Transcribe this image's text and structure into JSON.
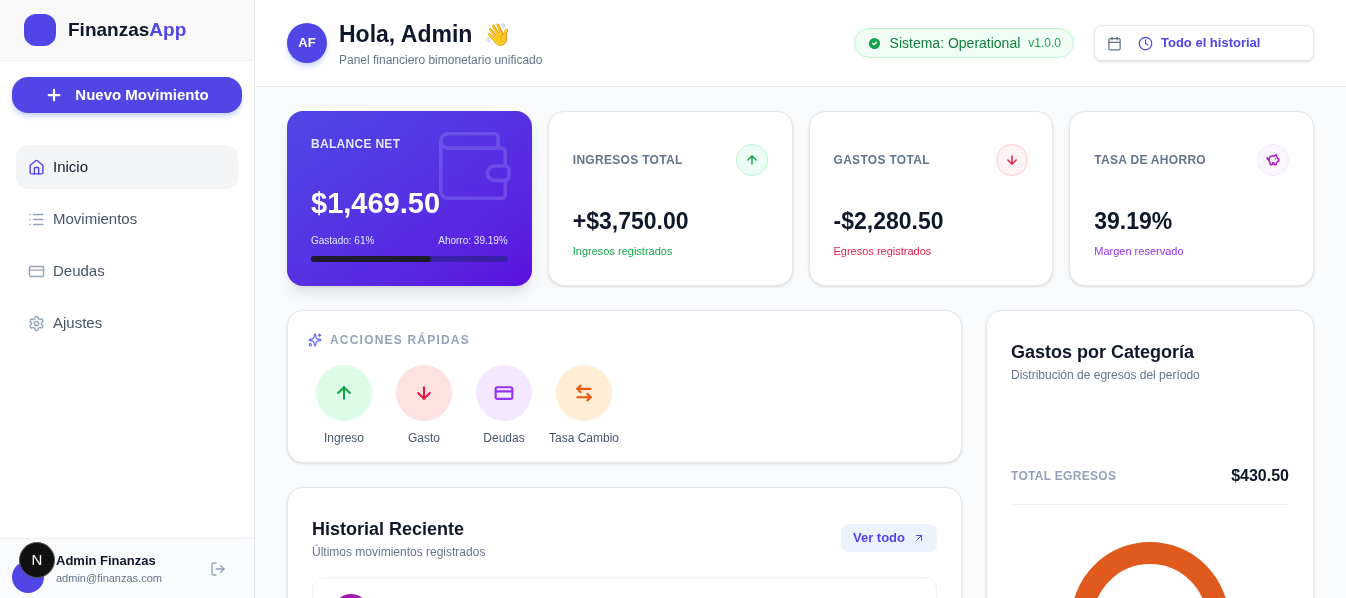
{
  "brand": {
    "name": "Finanzas",
    "accent": "App"
  },
  "new_button": "Nuevo Movimiento",
  "nav": [
    {
      "label": "Inicio",
      "kind": "home",
      "selected": true
    },
    {
      "label": "Movimientos",
      "kind": "list",
      "selected": false
    },
    {
      "label": "Deudas",
      "kind": "card",
      "selected": false
    },
    {
      "label": "Ajustes",
      "kind": "gear",
      "selected": false
    }
  ],
  "user": {
    "initial": "N",
    "name": "Admin Finanzas",
    "email": "admin@finanzas.com"
  },
  "header": {
    "avatar": "AF",
    "title": "Hola, Admin",
    "emoji": "👋",
    "subtitle": "Panel financiero bimonetario unificado",
    "status": "Sistema: Operational",
    "version": "v1.0.0",
    "range": "Todo el historial"
  },
  "balance": {
    "label": "BALANCE NET",
    "value": "$1,469.50",
    "spent": "Gastado: 61%",
    "saved": "Ahorro: 39.19%",
    "level": 0.61
  },
  "stats": [
    {
      "label": "INGRESOS TOTAL",
      "value": "+$3,750.00",
      "note": "Ingresos registrados",
      "kind": "up"
    },
    {
      "label": "GASTOS TOTAL",
      "value": "-$2,280.50",
      "note": "Egresos registrados",
      "kind": "down"
    },
    {
      "label": "TASA DE AHORRO",
      "value": "39.19%",
      "note": "Margen reservado",
      "kind": "piggy"
    }
  ],
  "quick_actions": {
    "title": "ACCIONES RÁPIDAS",
    "items": [
      {
        "label": "Ingreso",
        "kind": "up"
      },
      {
        "label": "Gasto",
        "kind": "down"
      },
      {
        "label": "Deudas",
        "kind": "card"
      },
      {
        "label": "Tasa Cambio",
        "kind": "swap"
      }
    ]
  },
  "history": {
    "title": "Historial Reciente",
    "subtitle": "Últimos movimientos registrados",
    "link": "Ver todo"
  },
  "categories": {
    "title": "Gastos por Categoría",
    "subtitle": "Distribución de egresos del período",
    "total_label": "TOTAL EGRESOS",
    "total": "$430.50"
  }
}
